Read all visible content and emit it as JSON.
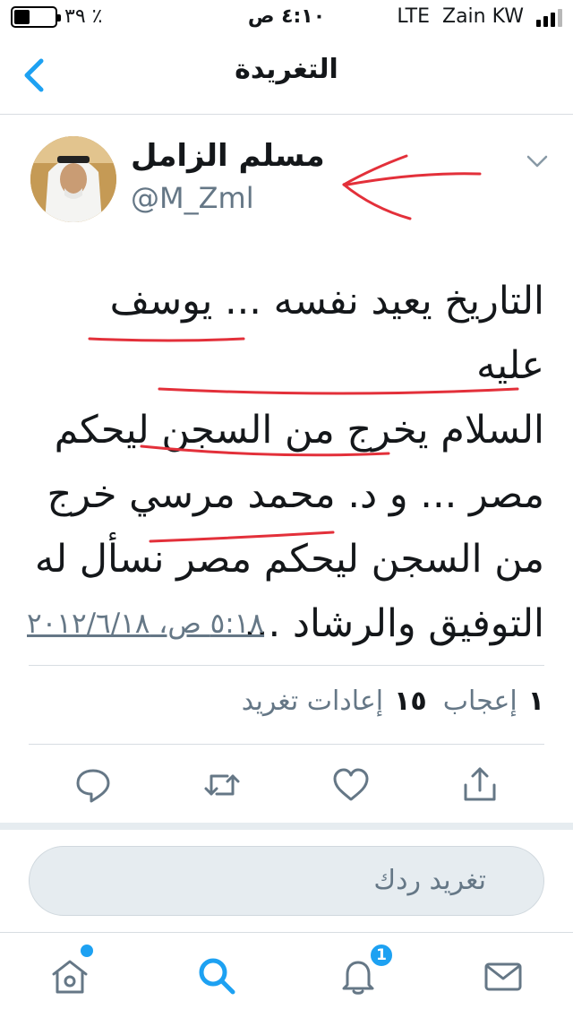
{
  "status_bar": {
    "battery_text": "٣٩ ٪",
    "battery_level": 0.39,
    "time": "٤:١٠ ص",
    "network": "LTE",
    "carrier": "Zain KW",
    "signal_bars": 3
  },
  "nav": {
    "title": "التغريدة",
    "back_icon": "chevron-left-icon"
  },
  "tweet": {
    "author_name": "مسلم الزامل",
    "author_handle": "@M_Zml",
    "text_lines": [
      "التاريخ يعيد نفسه ... يوسف عليه",
      "السلام يخرج من السجن ليحكم",
      "مصر ... و د. محمد مرسي خرج",
      "من السجن ليحكم مصر نسأل له",
      "التوفيق والرشاد ..."
    ],
    "timestamp": "٥:١٨ ص، ٢٠١٢/٦/١٨",
    "retweet_count": "١٥",
    "retweet_label": "إعادات تغريد",
    "like_count": "١",
    "like_label": "إعجاب"
  },
  "actions": {
    "reply_icon": "reply-icon",
    "retweet_icon": "retweet-icon",
    "like_icon": "heart-icon",
    "share_icon": "share-icon"
  },
  "reply": {
    "placeholder": "تغريد ردك"
  },
  "tabs": {
    "home_icon": "home-icon",
    "search_icon": "search-icon",
    "notifications_icon": "bell-icon",
    "notifications_badge": "1",
    "messages_icon": "mail-icon"
  },
  "colors": {
    "accent": "#1da1f2",
    "annotation": "#e3303a",
    "secondary_text": "#657786"
  }
}
